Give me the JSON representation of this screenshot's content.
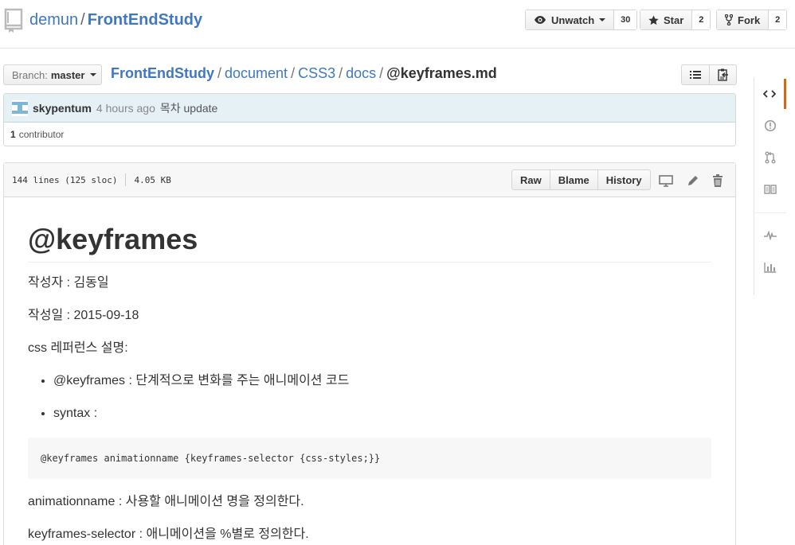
{
  "repo": {
    "owner": "demun",
    "separator": "/",
    "name": "FrontEndStudy"
  },
  "social": {
    "watch_label": "Unwatch",
    "watch_count": "30",
    "star_label": "Star",
    "star_count": "2",
    "fork_label": "Fork",
    "fork_count": "2"
  },
  "branch": {
    "label": "Branch:",
    "value": "master"
  },
  "breadcrumb": {
    "root": "FrontEndStudy",
    "parts": [
      "document",
      "CSS3",
      "docs"
    ],
    "current": "@keyframes.md",
    "separator": "/"
  },
  "commit": {
    "author": "skypentum",
    "time": "4 hours ago",
    "message": "목차 update",
    "contributor_count": "1",
    "contributor_label": "contributor"
  },
  "file": {
    "lines": "144 lines (125 sloc)",
    "size": "4.05 KB",
    "actions": {
      "raw": "Raw",
      "blame": "Blame",
      "history": "History"
    }
  },
  "content": {
    "title": "@keyframes",
    "author_line": "작성자 : 김동일",
    "date_line": "작성일 : 2015-09-18",
    "ref_line": "css 레퍼런스 설명:",
    "bullets": [
      "@keyframes : 단계적으로 변화를 주는 애니메이션 코드",
      "syntax :"
    ],
    "code": "@keyframes animationname {keyframes-selector {css-styles;}}",
    "p_animationname": "animationname : 사용할 애니메이션 명을 정의한다.",
    "p_selector": "keyframes-selector : 애니메이션을 %별로 정의한다."
  },
  "colors": {
    "link": "#4078c0",
    "active_tab": "#d26911",
    "commit_bg": "#e6f1f6"
  },
  "icons": {
    "sidenav": [
      "code-icon",
      "issue-icon",
      "pull-request-icon",
      "wiki-icon",
      "pulse-icon",
      "graph-icon"
    ]
  }
}
